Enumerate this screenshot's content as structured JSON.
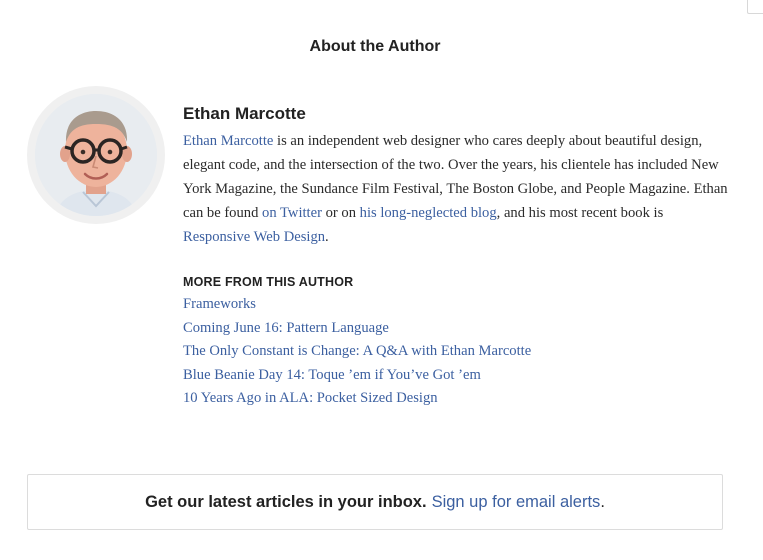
{
  "section": {
    "title": "About the Author"
  },
  "author": {
    "name": "Ethan Marcotte",
    "bio": {
      "name_link": "Ethan Marcotte",
      "text1": " is an independent web designer who cares deeply about beautiful design, elegant code, and the intersection of the two. Over the years, his clientele has included New York Magazine, the Sundance Film Festival, The Boston Globe, and People Magazine. Ethan can be found ",
      "twitter_link": "on Twitter",
      "text2": " or on ",
      "blog_link": "his long-neglected blog",
      "text3": ", and his most recent book is ",
      "book_link": "Responsive Web Design",
      "text4": "."
    },
    "avatar_icon": "author-photo"
  },
  "more": {
    "heading": "MORE FROM THIS AUTHOR",
    "articles": [
      "Frameworks",
      "Coming June 16: Pattern Language",
      "The Only Constant is Change: A Q&A with Ethan Marcotte",
      "Blue Beanie Day 14: Toque ’em if You’ve Got ’em",
      "10 Years Ago in ALA: Pocket Sized Design"
    ]
  },
  "signup": {
    "strong_text": "Get our latest articles in your inbox.",
    "link_text": "Sign up for email alerts",
    "period": "."
  },
  "colors": {
    "link": "#3b5fa0",
    "text": "#222222",
    "border": "#dcdcdc"
  }
}
